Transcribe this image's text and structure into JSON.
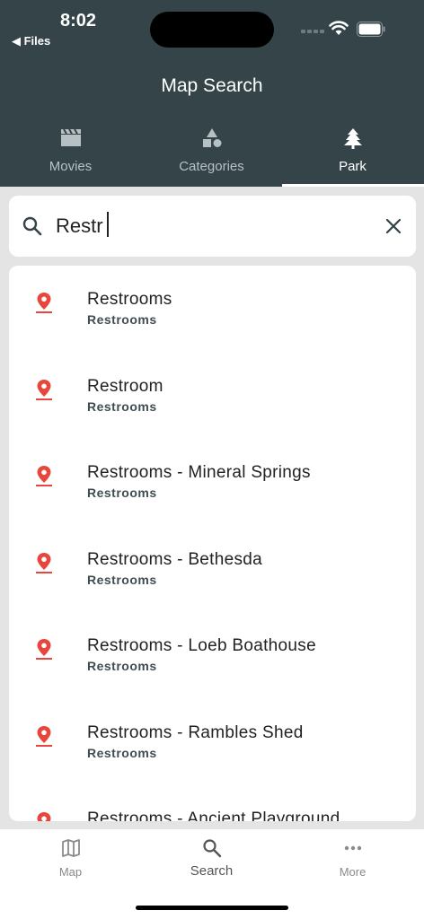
{
  "status": {
    "time": "8:02",
    "back_label": "◀ Files"
  },
  "header": {
    "title": "Map Search"
  },
  "tabs": [
    {
      "label": "Movies",
      "icon": "clapperboard-icon"
    },
    {
      "label": "Categories",
      "icon": "shapes-icon"
    },
    {
      "label": "Park",
      "icon": "tree-icon",
      "active": true
    }
  ],
  "search": {
    "value": "Restr",
    "placeholder": ""
  },
  "results": [
    {
      "title": "Restrooms",
      "category": "Restrooms"
    },
    {
      "title": "Restroom",
      "category": "Restrooms"
    },
    {
      "title": "Restrooms - Mineral Springs",
      "category": "Restrooms"
    },
    {
      "title": "Restrooms - Bethesda",
      "category": "Restrooms"
    },
    {
      "title": "Restrooms - Loeb Boathouse",
      "category": "Restrooms"
    },
    {
      "title": "Restrooms - Rambles Shed",
      "category": "Restrooms"
    },
    {
      "title": "Restrooms - Ancient Playground",
      "category": ""
    }
  ],
  "bottom_nav": [
    {
      "label": "Map",
      "icon": "map-icon"
    },
    {
      "label": "Search",
      "icon": "search-icon",
      "active": true
    },
    {
      "label": "More",
      "icon": "more-icon"
    }
  ],
  "colors": {
    "header_bg": "#344449",
    "pin": "#e8453c",
    "page_bg": "#e4e4e4"
  }
}
